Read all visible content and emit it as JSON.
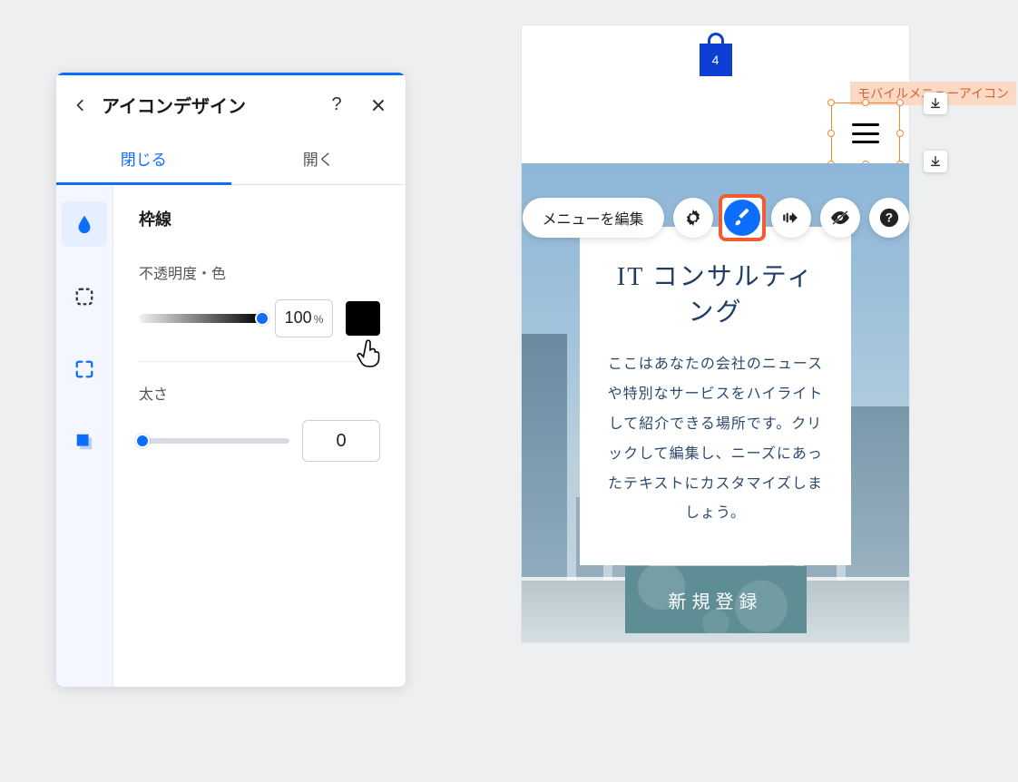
{
  "panel": {
    "title": "アイコンデザイン",
    "tabs": [
      "閉じる",
      "開く"
    ],
    "activeTabIndex": 0,
    "section": {
      "title": "枠線",
      "opacity": {
        "label": "不透明度・色",
        "value": "100",
        "unit": "%",
        "colorHex": "#000000"
      },
      "thickness": {
        "label": "太さ",
        "value": "0"
      }
    },
    "sideIcons": [
      "fill-icon",
      "border-dashed-icon",
      "corners-icon",
      "shadow-icon"
    ]
  },
  "selection": {
    "label": "モバイルメニューアイコン"
  },
  "cart": {
    "count": "4"
  },
  "toolbar": {
    "editLabel": "メニューを編集",
    "icons": [
      "gear-icon",
      "brush-icon",
      "animation-icon",
      "visibility-off-icon",
      "help-icon"
    ],
    "highlightedIndex": 1
  },
  "hero": {
    "cardTitle": "IT コンサルティング",
    "cardBody": "ここはあなたの会社のニュースや特別なサービスをハイライトして紹介できる場所です。クリックして編集し、ニーズにあったテキストにカスタマイズしましょう。",
    "ctaLabel": "新規登録"
  }
}
